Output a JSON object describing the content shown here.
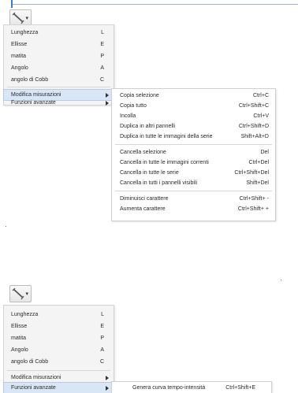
{
  "colors": {
    "accent": "#3a7bd5",
    "highlight": "#d9e6f5",
    "menu_bg": "#f4f4f4"
  },
  "tool_button": {
    "icon": "measure-line-icon"
  },
  "main_menu": {
    "items": [
      {
        "label": "Lunghezza",
        "shortcut": "L"
      },
      {
        "label": "Ellisse",
        "shortcut": "E"
      },
      {
        "label": "matita",
        "shortcut": "P"
      },
      {
        "label": "Angolo",
        "shortcut": "A"
      },
      {
        "label": "angolo di Cobb",
        "shortcut": "C"
      }
    ],
    "modify": "Modifica misurazioni",
    "advanced": "Funzioni avanzate"
  },
  "modify_submenu": {
    "items": [
      {
        "label": "Copia selezione",
        "shortcut": "Ctrl+C"
      },
      {
        "label": "Copia tutto",
        "shortcut": "Ctrl+Shift+C"
      },
      {
        "label": "Incolla",
        "shortcut": "Ctrl+V"
      },
      {
        "label": "Duplica in altri pannelli",
        "shortcut": "Ctrl+Shift+D"
      },
      {
        "label": "Duplica in tutte le immagini della serie",
        "shortcut": "Shift+Alt+D"
      },
      {
        "label": "Cancella selezione",
        "shortcut": "Del"
      },
      {
        "label": "Cancella in tutte le immagini correnti",
        "shortcut": "Ctrl+Del"
      },
      {
        "label": "Cancella in tutte le serie",
        "shortcut": "Ctrl+Shift+Del"
      },
      {
        "label": "Cancella in tutti i pannelli visibili",
        "shortcut": "Shift+Del"
      },
      {
        "label": "Diminuisci carattere",
        "shortcut": "Ctrl+Shift+ -"
      },
      {
        "label": "Aumenta carattere",
        "shortcut": "Ctrl+Shift+ +"
      }
    ]
  },
  "advanced_submenu": {
    "items": [
      {
        "label": "Genera curva tempo-intensità",
        "shortcut": "Ctrl+Shift+E"
      }
    ]
  }
}
